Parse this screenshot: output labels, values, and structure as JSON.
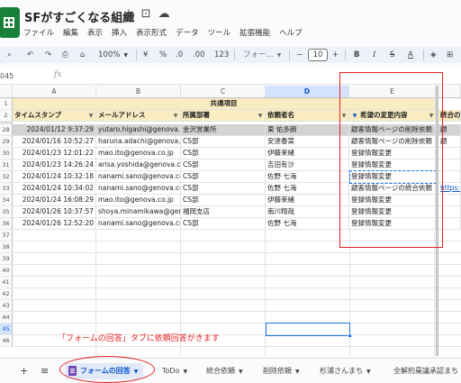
{
  "app": {
    "doc_title": "SFがすごくなる組織"
  },
  "menu": [
    "ファイル",
    "編集",
    "表示",
    "挿入",
    "表示形式",
    "データ",
    "ツール",
    "拡張機能",
    "ヘルプ"
  ],
  "toolbar": {
    "zoom": "100%",
    "currency": "¥",
    "percent": "%",
    "dec_minus": ".0",
    "dec_plus": ".00",
    "number_format": "123",
    "font": "フォー...",
    "font_size": "10"
  },
  "formula_bar": {
    "name_box": "045",
    "fx": "fx"
  },
  "sheet": {
    "columns": [
      "A",
      "B",
      "C",
      "D",
      "E"
    ],
    "selected_column": "D",
    "group_label": "共通項目",
    "headers": [
      "タイムスタンプ",
      "メールアドレス",
      "所属部署",
      "依頼者名",
      "希望の変更内容",
      "統合の"
    ],
    "row_numbers": [
      "1",
      "2",
      "28",
      "29",
      "30",
      "31",
      "32",
      "33",
      "34",
      "35",
      "36",
      "37",
      "38",
      "39",
      "40",
      "41",
      "42",
      "43",
      "44",
      "45",
      "46"
    ],
    "selected_row": "45",
    "rows": [
      {
        "num": "28",
        "ts": "2024/01/12 9:37:29",
        "email": "yutaro.higashi@genova.co.jp",
        "dept": "金沢営業所",
        "name": "東 佑多朗",
        "change": "顧客情報ページの削除依頼",
        "extra": "顧"
      },
      {
        "num": "29",
        "ts": "2024/01/16 10:52:27",
        "email": "haruna.adachi@genova.co.jp",
        "dept": "CS部",
        "name": "安達春菜",
        "change": "顧客情報ページの削除依頼",
        "extra": "顧"
      },
      {
        "num": "30",
        "ts": "2024/01/23 12:01:22",
        "email": "mao.ito@genova.co.jp",
        "dept": "CS部",
        "name": "伊藤茉緒",
        "change": "登録情報変更",
        "extra": ""
      },
      {
        "num": "31",
        "ts": "2024/01/23 14:26:24",
        "email": "arisa.yoshida@genova.co.jp",
        "dept": "CS部",
        "name": "吉田有沙",
        "change": "登録情報変更",
        "extra": ""
      },
      {
        "num": "32",
        "ts": "2024/01/24 10:32:18",
        "email": "nanami.sano@genova.co.jp",
        "dept": "CS部",
        "name": "佐野 七海",
        "change": "登録情報変更",
        "extra": ""
      },
      {
        "num": "33",
        "ts": "2024/01/24 10:34:02",
        "email": "nanami.sano@genova.co.jp",
        "dept": "CS部",
        "name": "佐野 七海",
        "change": "顧客情報ページの統合依頼",
        "extra": "https://"
      },
      {
        "num": "34",
        "ts": "2024/01/24 16:08:29",
        "email": "mao.ito@genova.co.jp",
        "dept": "CS部",
        "name": "伊藤茉緒",
        "change": "登録情報変更",
        "extra": ""
      },
      {
        "num": "35",
        "ts": "2024/01/26 10:37:57",
        "email": "shoya.minamikawa@genova.co.jp",
        "dept": "福岡支店",
        "name": "南川翔哉",
        "change": "登録情報変更",
        "extra": ""
      },
      {
        "num": "36",
        "ts": "2024/01/26 12:52:20",
        "email": "nanami.sano@genova.co.jp",
        "dept": "CS部",
        "name": "佐野 七海",
        "change": "登録情報変更",
        "extra": ""
      }
    ]
  },
  "annotation": {
    "note": "「フォームの回答」タブに依頼回答がきます"
  },
  "tabs": {
    "add": "+",
    "list": "≡",
    "items": [
      "フォームの回答",
      "ToDo",
      "統合依頼",
      "削除依頼",
      "杉浦さんまち",
      "全解約稟議承認まち"
    ]
  },
  "colors": {
    "accent": "#0b57d0",
    "group_fill": "#f9ecc2",
    "annotation_red": "#e32222",
    "sheets_green": "#188038"
  }
}
